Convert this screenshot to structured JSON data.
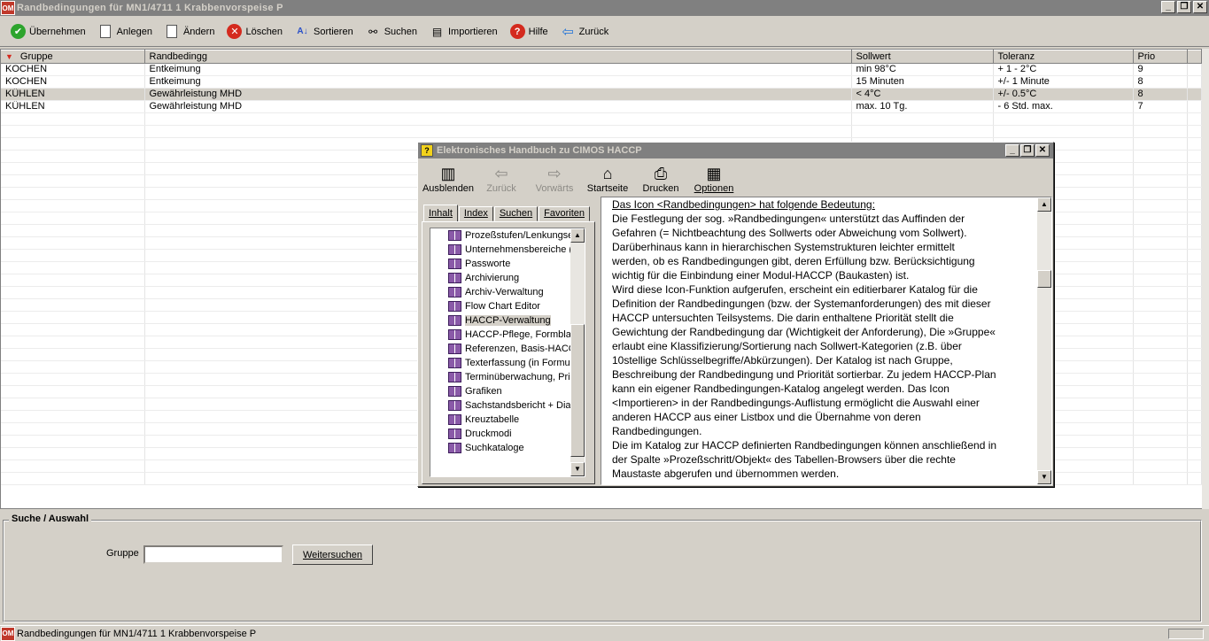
{
  "window": {
    "title": "Randbedingungen für  MN1/4711  1  Krabbenvorspeise  P",
    "app_icon": "OM",
    "controls": {
      "minimize": "_",
      "maximize": "❐",
      "close": "✕"
    }
  },
  "toolbar": {
    "items": [
      {
        "label": "Übernehmen",
        "icon": "check-icon"
      },
      {
        "label": "Anlegen",
        "icon": "new-document-icon"
      },
      {
        "label": "Ändern",
        "icon": "edit-document-icon"
      },
      {
        "label": "Löschen",
        "icon": "delete-icon"
      },
      {
        "label": "Sortieren",
        "icon": "sort-icon"
      },
      {
        "label": "Suchen",
        "icon": "binoculars-icon"
      },
      {
        "label": "Importieren",
        "icon": "import-icon"
      },
      {
        "label": "Hilfe",
        "icon": "help-icon"
      },
      {
        "label": "Zurück",
        "icon": "back-arrow-icon"
      }
    ]
  },
  "grid": {
    "columns": [
      "Gruppe",
      "Randbedingg",
      "Sollwert",
      "Toleranz",
      "Prio"
    ],
    "rows": [
      [
        "KOCHEN",
        "Entkeimung",
        "min 98°C",
        "+ 1 - 2°C",
        "9"
      ],
      [
        "KOCHEN",
        "Entkeimung",
        "15 Minuten",
        "+/- 1 Minute",
        "8"
      ],
      [
        "KÜHLEN",
        "Gewährleistung MHD",
        "< 4°C",
        "+/- 0.5°C",
        "8"
      ],
      [
        "KÜHLEN",
        "Gewährleistung MHD",
        "max. 10 Tg.",
        "- 6 Std. max.",
        "7"
      ]
    ],
    "selected_row": 2
  },
  "help": {
    "title": "Elektronisches Handbuch zu CIMOS HACCP",
    "toolbar": [
      {
        "label": "Ausblenden",
        "icon": "hide-pane-icon",
        "enabled": true
      },
      {
        "label": "Zurück",
        "icon": "back-icon",
        "enabled": false
      },
      {
        "label": "Vorwärts",
        "icon": "forward-icon",
        "enabled": false
      },
      {
        "label": "Startseite",
        "icon": "home-icon",
        "enabled": true
      },
      {
        "label": "Drucken",
        "icon": "printer-icon",
        "enabled": true
      },
      {
        "label": "Optionen",
        "icon": "options-icon",
        "enabled": true
      }
    ],
    "tabs": [
      "Inhalt",
      "Index",
      "Suchen",
      "Favoriten"
    ],
    "tree": [
      "Prozeßstufen/Lenkungse",
      "Unternehmensbereiche (l",
      "Passworte",
      "Archivierung",
      "Archiv-Verwaltung",
      "Flow Chart Editor",
      "HACCP-Verwaltung",
      "HACCP-Pflege, Formblatt",
      "Referenzen, Basis-HACC",
      "Texterfassung (in Formula",
      "Terminüberwachung, Pric",
      "Grafiken",
      "Sachstandsbericht + Diag",
      "Kreuztabelle",
      "Druckmodi",
      "Suchkataloge"
    ],
    "tree_selected": 6,
    "content_heading": "Das Icon <Randbedingungen> hat folgende Bedeutung:",
    "content_lines": [
      "Die Festlegung der sog. »Randbedingungen« unterstützt das Auffinden der",
      "Gefahren (= Nichtbeachtung des Sollwerts oder Abweichung vom Sollwert).",
      "Darüberhinaus kann in hierarchischen Systemstrukturen leichter ermittelt",
      "werden, ob es Randbedingungen gibt, deren Erfüllung bzw. Berücksichtigung",
      "wichtig für die Einbindung einer Modul-HACCP (Baukasten) ist.",
      "Wird diese Icon-Funktion aufgerufen, erscheint ein editierbarer Katalog für die",
      "Definition der Randbedingungen (bzw. der Systemanforderungen) des mit dieser",
      "HACCP untersuchten Teilsystems. Die darin enthaltene Priorität stellt die",
      "Gewichtung der Randbedingung dar (Wichtigkeit der  Anforderung), Die »Gruppe«",
      "erlaubt eine Klassifizierung/Sortierung nach Sollwert-Kategorien (z.B. über",
      "10stellige Schlüsselbegriffe/Abkürzungen). Der Katalog ist nach Gruppe,",
      "Beschreibung der Randbedingung und Priorität sortierbar. Zu jedem HACCP-Plan",
      "kann ein eigener Randbedingungen-Katalog angelegt werden. Das Icon",
      "<Importieren> in der Randbedingungs-Auflistung ermöglicht die Auswahl einer",
      "anderen HACCP aus einer Listbox und die Übernahme von deren",
      "Randbedingungen.",
      "Die im Katalog zur HACCP definierten Randbedingungen können anschließend in",
      "der Spalte »Prozeßschritt/Objekt« des Tabellen-Browsers über die rechte",
      "Maustaste abgerufen und übernommen werden."
    ]
  },
  "search": {
    "legend": "Suche / Auswahl",
    "field_label": "Gruppe",
    "field_value": "",
    "button_label": "Weitersuchen"
  },
  "statusbar": {
    "text": "Randbedingungen für  MN1/4711  1  Krabbenvorspeise  P"
  },
  "colors": {
    "face": "#d4d0c8",
    "titlebar_inactive": "#808080",
    "accent_red": "#d42a1e",
    "accent_green": "#2da42d",
    "accent_blue": "#2a78d8"
  }
}
